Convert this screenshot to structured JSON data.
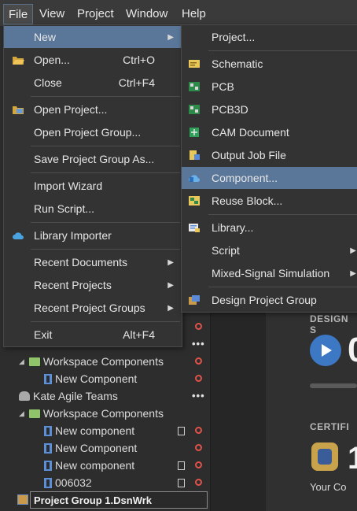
{
  "menubar": {
    "file": "File",
    "view": "View",
    "project": "Project",
    "window": "Window",
    "help": "Help"
  },
  "file_menu": {
    "new": "New",
    "open": "Open...",
    "open_shortcut": "Ctrl+O",
    "close": "Close",
    "close_shortcut": "Ctrl+F4",
    "open_project": "Open Project...",
    "open_project_group": "Open Project Group...",
    "save_project_group_as": "Save Project Group As...",
    "import_wizard": "Import Wizard",
    "run_script": "Run Script...",
    "library_importer": "Library Importer",
    "recent_documents": "Recent Documents",
    "recent_projects": "Recent Projects",
    "recent_project_groups": "Recent Project Groups",
    "exit": "Exit",
    "exit_shortcut": "Alt+F4"
  },
  "new_submenu": {
    "project": "Project...",
    "schematic": "Schematic",
    "pcb": "PCB",
    "pcb3d": "PCB3D",
    "cam_document": "CAM Document",
    "output_job_file": "Output Job File",
    "component": "Component...",
    "reuse_block": "Reuse Block...",
    "library": "Library...",
    "script": "Script",
    "mixed_signal_simulation": "Mixed-Signal Simulation",
    "design_project_group": "Design Project Group"
  },
  "tree": {
    "workspace_components_1": "Workspace Components",
    "new_component_1": "New Component",
    "kate_agile_teams": "Kate Agile Teams",
    "workspace_components_2": "Workspace Components",
    "new_component_2": "New component",
    "new_component_3": "New Component",
    "new_component_4": "New component",
    "item_006032": "006032",
    "project_group": "Project Group 1.DsnWrk"
  },
  "home": {
    "design_s": "DESIGN S",
    "big_number": "0",
    "certif": "CERTIFI",
    "big_one": "1",
    "your_co": "Your Co"
  }
}
